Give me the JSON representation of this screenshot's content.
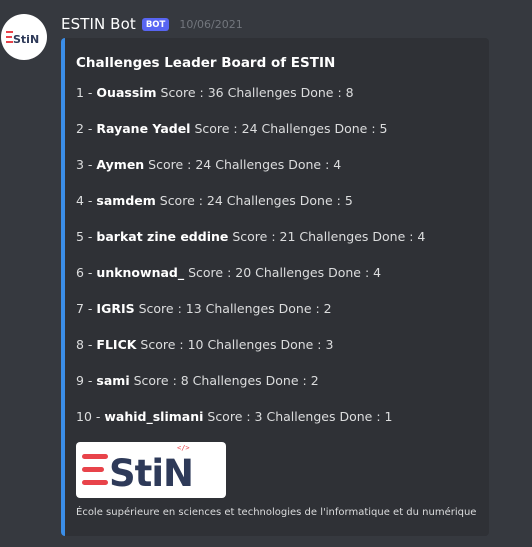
{
  "message": {
    "author": "ESTIN Bot",
    "badge": "BOT",
    "timestamp": "10/06/2021",
    "avatar_text": "EStiN"
  },
  "embed": {
    "accent_color": "#3b8ee8",
    "title": "Challenges Leader Board of ESTIN",
    "leaderboard": [
      {
        "rank": "1 - ",
        "name": "Ouassim",
        "details": " Score : 36 Challenges Done : 8"
      },
      {
        "rank": "2 - ",
        "name": "Rayane Yadel",
        "details": " Score : 24 Challenges Done : 5"
      },
      {
        "rank": "3 - ",
        "name": "Aymen",
        "details": " Score : 24 Challenges Done : 4"
      },
      {
        "rank": "4 - ",
        "name": "samdem",
        "details": " Score : 24 Challenges Done : 5"
      },
      {
        "rank": "5 - ",
        "name": "barkat zine eddine",
        "details": " Score : 21 Challenges Done : 4"
      },
      {
        "rank": "6 - ",
        "name": "unknownad_",
        "details": " Score : 20 Challenges Done : 4"
      },
      {
        "rank": "7 - ",
        "name": "IGRIS",
        "details": " Score : 13 Challenges Done : 2"
      },
      {
        "rank": "8 - ",
        "name": "FLICK",
        "details": " Score : 10 Challenges Done : 3"
      },
      {
        "rank": "9 - ",
        "name": "sami",
        "details": " Score : 8 Challenges Done : 2"
      },
      {
        "rank": "10 - ",
        "name": "wahid_slimani",
        "details": " Score : 3 Challenges Done : 1"
      }
    ],
    "image_logo_text": "EStiN",
    "footer": "École supérieure en sciences et technologies de l'informatique et du numérique"
  },
  "colors": {
    "background": "#36393f",
    "embed_bg": "#2f3136",
    "badge": "#5865f2",
    "logo_red": "#e8434a",
    "logo_navy": "#2e3a59"
  },
  "icons": [
    "estin-logo-icon",
    "code-brackets-icon"
  ]
}
